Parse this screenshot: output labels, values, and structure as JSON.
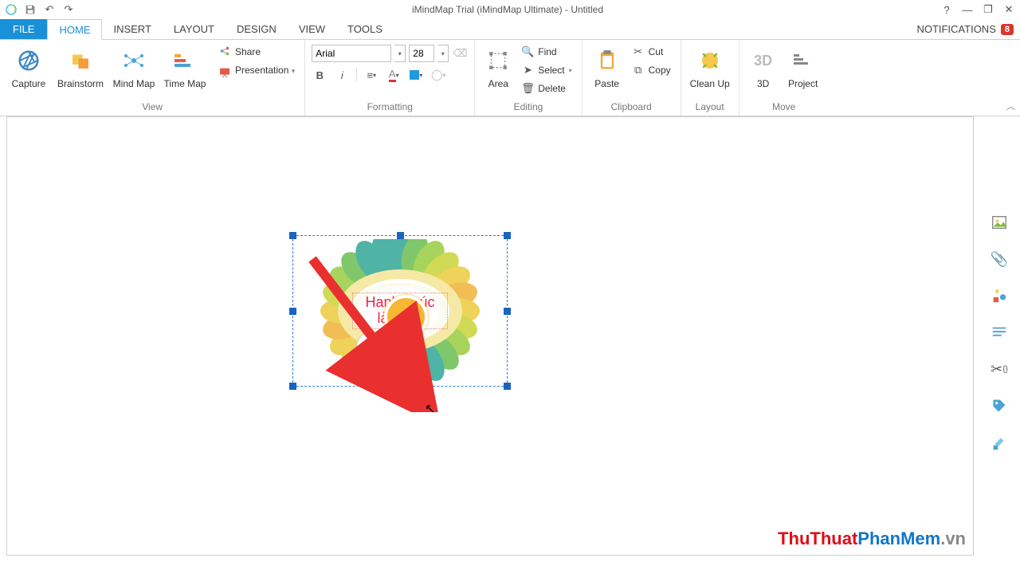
{
  "title": "iMindMap Trial (iMindMap Ultimate) - Untitled",
  "titlebar": {
    "help": "?",
    "minimize": "—",
    "restore": "❐",
    "close": "✕"
  },
  "tabs": {
    "file": "FILE",
    "home": "HOME",
    "insert": "INSERT",
    "layout": "LAYOUT",
    "design": "DESIGN",
    "view": "VIEW",
    "tools": "TOOLS"
  },
  "notifications": {
    "label": "NOTIFICATIONS",
    "count": "8"
  },
  "ribbon": {
    "view": {
      "label": "View",
      "capture": "Capture",
      "brainstorm": "Brainstorm",
      "mindmap": "Mind Map",
      "timemap": "Time Map",
      "share": "Share",
      "presentation": "Presentation"
    },
    "formatting": {
      "label": "Formatting",
      "font": "Arial",
      "size": "28",
      "bold": "B",
      "italic": "i"
    },
    "editing": {
      "label": "Editing",
      "area": "Area",
      "find": "Find",
      "select": "Select",
      "delete": "Delete"
    },
    "clipboard": {
      "label": "Clipboard",
      "paste": "Paste",
      "cut": "Cut",
      "copy": "Copy"
    },
    "layout": {
      "label": "Layout",
      "cleanup": "Clean Up"
    },
    "move": {
      "label": "Move",
      "three_d": "3D",
      "project": "Project"
    }
  },
  "central_idea": "Hanh phúc là lagi?",
  "watermark": {
    "part1": "ThuThuat",
    "part2": "PhanMem",
    "part3": ".vn"
  }
}
